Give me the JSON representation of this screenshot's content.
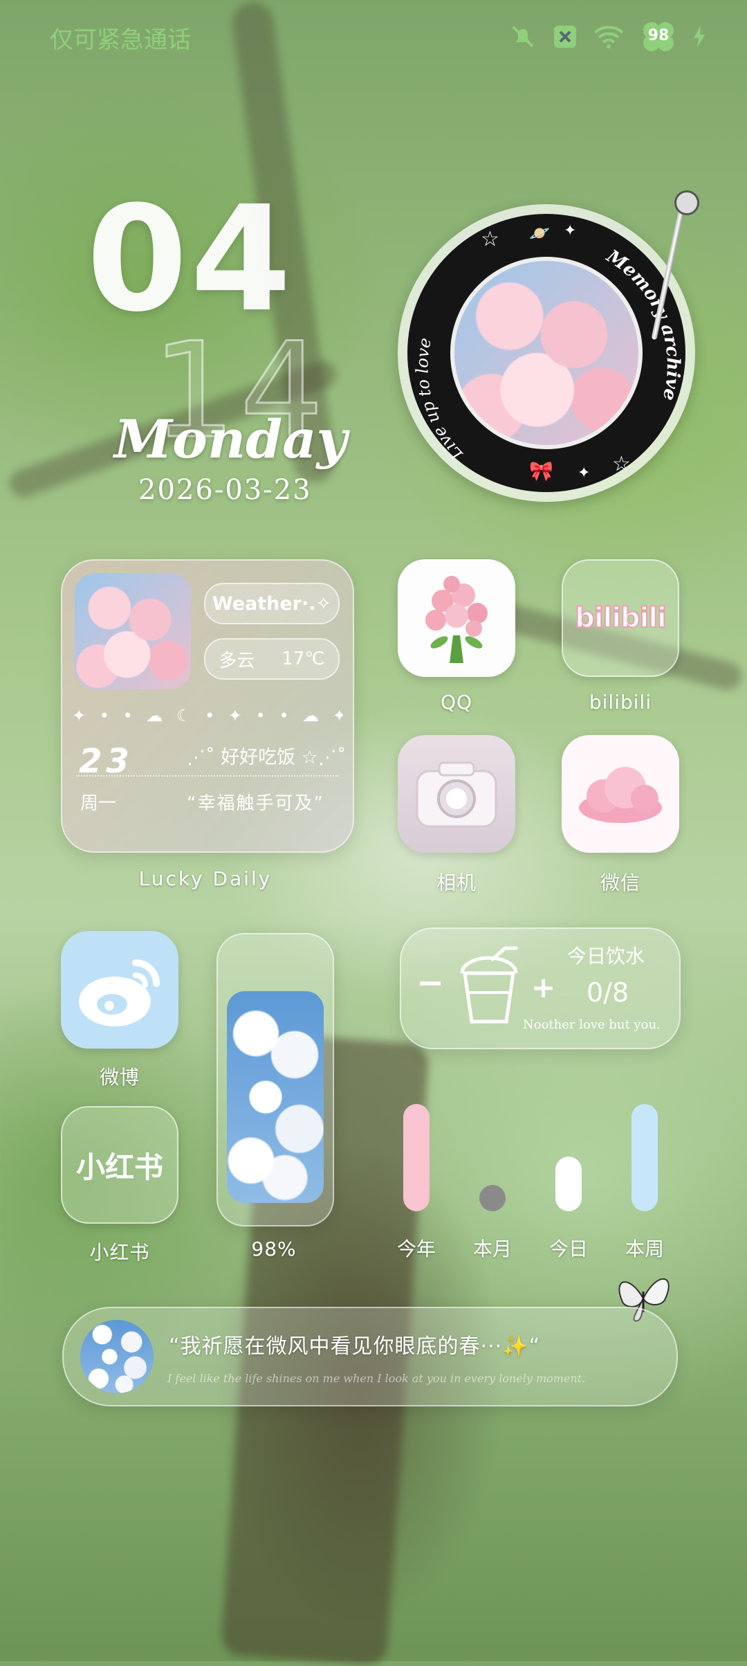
{
  "status_bar": {
    "left_text": "仅可紧急通话",
    "icons": [
      "mute-icon",
      "sim-off-icon",
      "wifi-icon",
      "battery-icon",
      "charging-icon"
    ],
    "battery": "98"
  },
  "clock": {
    "hour": "04",
    "minute": "14",
    "weekday": "Monday",
    "date": "2026-03-23"
  },
  "record_widget": {
    "left_arc_text": "Live up to love",
    "right_arc_text": "Memory archive"
  },
  "lucky_daily": {
    "weather_label": "Weather·.✧",
    "condition": "多云",
    "temperature": "17℃",
    "symbols": "✦ • • ☁ ☾ • ✦ • • ☁ ✦",
    "day_number": "23",
    "weekday": "周一",
    "meal_text": "好好吃饭",
    "quote": "“幸福触手可及”",
    "widget_label": "Lucky Daily"
  },
  "apps": {
    "qq": "QQ",
    "bilibili": "bilibili",
    "bilibili_logo": "bilibili",
    "camera": "相机",
    "wechat": "微信",
    "weibo": "微博",
    "xiaohongshu": "小红书",
    "xiaohongshu_logo": "小红书"
  },
  "photo_widget": {
    "percent": "98%"
  },
  "water_widget": {
    "title": "今日饮水",
    "minus": "−",
    "plus": "+",
    "count": "0/8",
    "caption": "Noother love but you."
  },
  "stats": {
    "bars": [
      {
        "label": "今年",
        "level": 1.0,
        "color": "#f7c4cf"
      },
      {
        "label": "本月",
        "level": 0.0,
        "color": "#8a8a8a"
      },
      {
        "label": "今日",
        "level": 0.35,
        "color": "#ffffff"
      },
      {
        "label": "本周",
        "level": 1.0,
        "color": "#c6e7fa"
      }
    ]
  },
  "quote_bar": {
    "text": "“我祈愿在微风中看见你眼底的春···✨“",
    "subtext": "I feel like the life shines on me when I look at you in every lonely moment."
  }
}
